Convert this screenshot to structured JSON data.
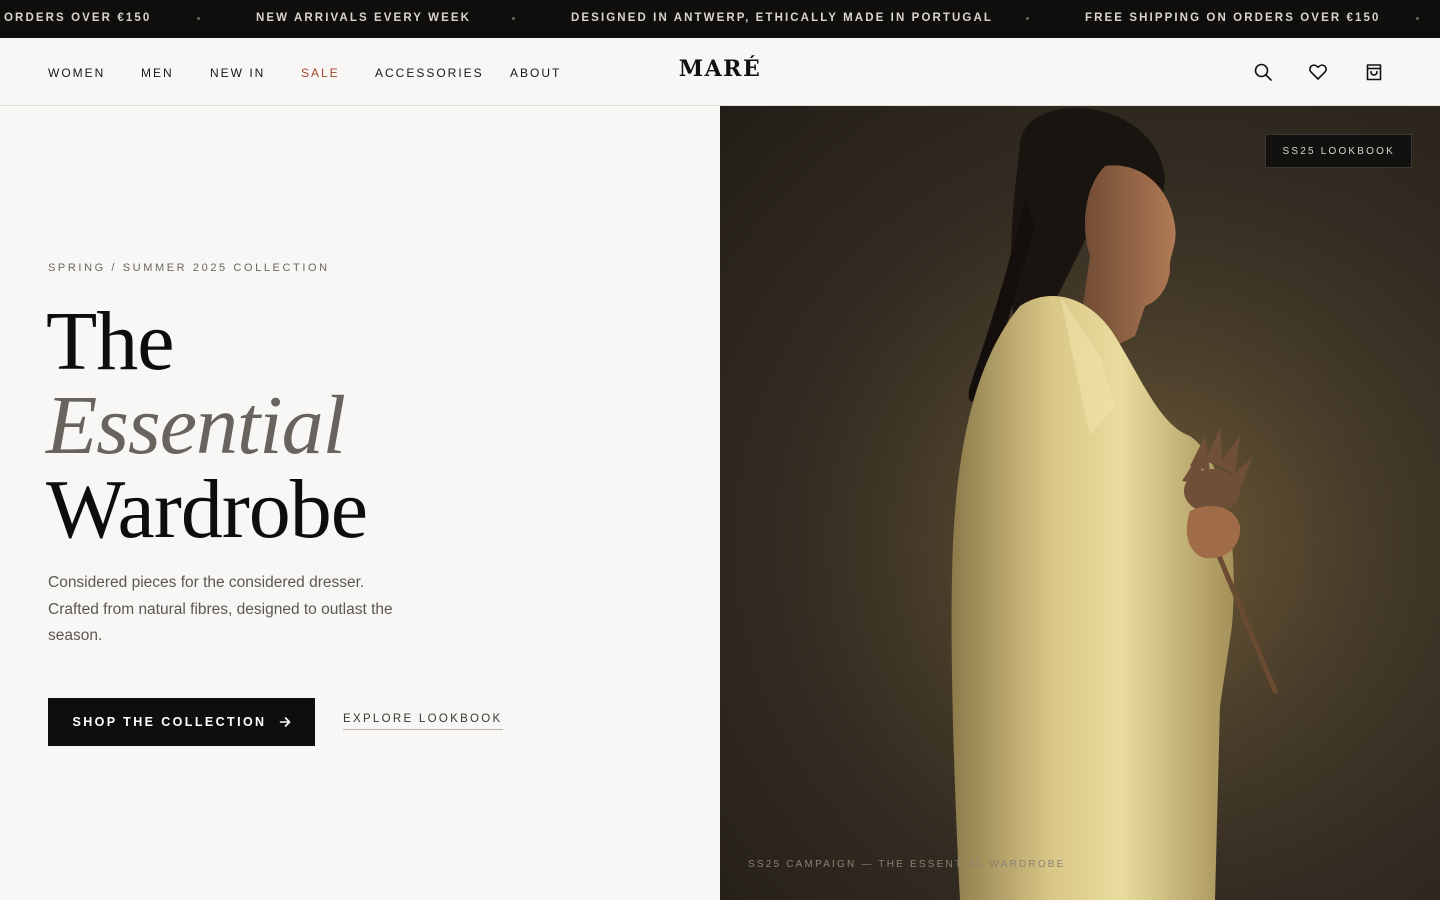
{
  "announcement": {
    "messages": [
      "Orders over €150",
      "New arrivals every week",
      "Designed in Antwerp, ethically made in Portugal",
      "Free shipping on orders over €150"
    ]
  },
  "header": {
    "nav": [
      "Women",
      "Men",
      "New In",
      "Sale",
      "Accessories",
      "About"
    ],
    "logo": "MARÉ",
    "icons": [
      "search-icon",
      "heart-icon",
      "bag-icon"
    ]
  },
  "hero": {
    "eyebrow": "Spring / Summer 2025 Collection",
    "headline": {
      "line1": "The",
      "line2": "Essential",
      "line3": "Wardrobe"
    },
    "description": "Considered pieces for the considered dresser. Crafted from natural fibres, designed to outlast the season.",
    "primary_cta": "Shop the Collection",
    "secondary_cta": "Explore Lookbook",
    "image_badge": "SS25 Lookbook",
    "image_caption": "SS25 Campaign — The Essential Wardrobe"
  },
  "colors": {
    "accent_sale": "#a3452e",
    "announcement_bg": "#0f0e0d",
    "page_bg": "#f8f7f5",
    "button_bg": "#0f0e0d"
  }
}
